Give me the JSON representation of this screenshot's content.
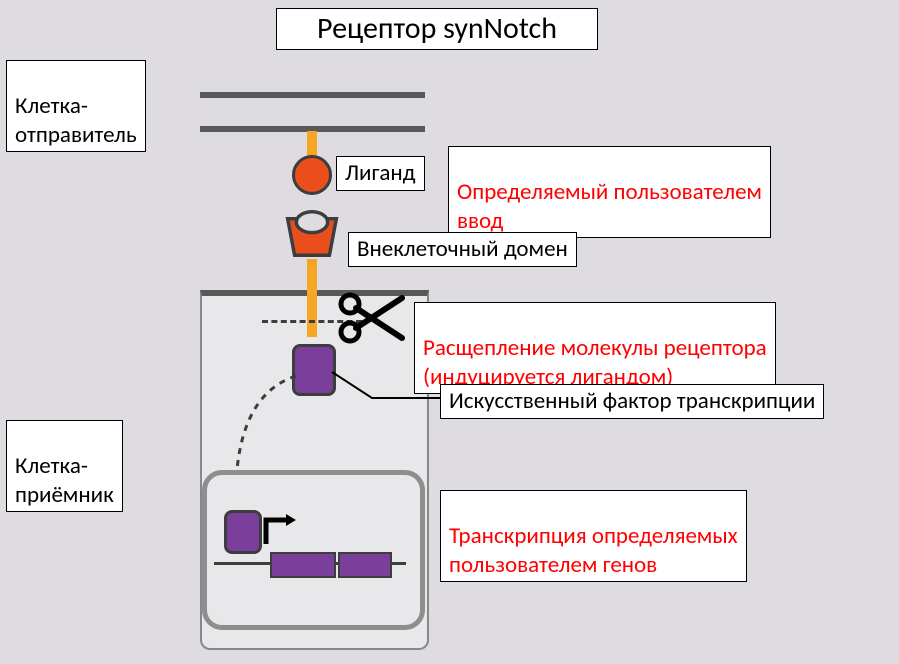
{
  "title": "Рецептор synNotch",
  "labels": {
    "sender": "Клетка-\nотправитель",
    "receiver": "Клетка-\nприёмник",
    "ligand": "Лиганд",
    "user_input": "Определяемый пользователем\nввод",
    "ecd": "Внеклеточный домен",
    "cleavage": "Расщепление молекулы рецептора\n(индуцируется лигандом)",
    "tf": "Искусственный фактор транскрипции",
    "transcription": "Транскрипция определяемых\nпользователем генов"
  },
  "colors": {
    "accent_orange": "#ea4e1d",
    "accent_purple": "#7a3f9a",
    "membrane": "#595959",
    "red_text": "#ff0000"
  }
}
